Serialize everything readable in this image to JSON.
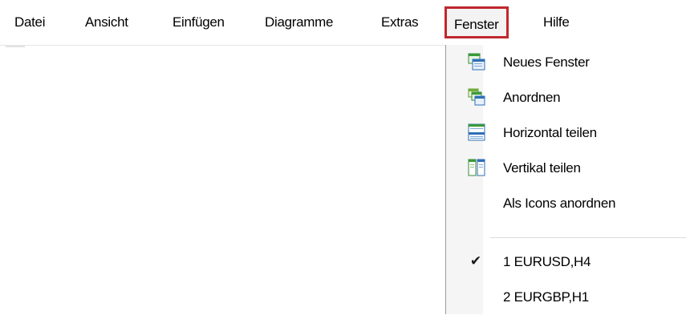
{
  "menubar": {
    "items": [
      {
        "label": "Datei"
      },
      {
        "label": "Ansicht"
      },
      {
        "label": "Einfügen"
      },
      {
        "label": "Diagramme"
      },
      {
        "label": "Extras"
      },
      {
        "label": "Fenster",
        "active": true
      },
      {
        "label": "Hilfe"
      }
    ]
  },
  "dropdown": {
    "items": [
      {
        "label": "Neues Fenster",
        "icon": "new-window-icon"
      },
      {
        "label": "Anordnen",
        "icon": "cascade-windows-icon"
      },
      {
        "label": "Horizontal teilen",
        "icon": "tile-horizontal-icon"
      },
      {
        "label": "Vertikal teilen",
        "icon": "tile-vertical-icon"
      },
      {
        "label": "Als Icons anordnen",
        "icon": null
      }
    ],
    "windows": [
      {
        "label": "1 EURUSD,H4",
        "checked": true,
        "check_glyph": "✔"
      },
      {
        "label": "2 EURGBP,H1",
        "checked": false
      }
    ]
  },
  "colors": {
    "highlight_border": "#c0272d",
    "icon_blue": "#2f6fb7",
    "icon_green": "#3a9a3a"
  }
}
